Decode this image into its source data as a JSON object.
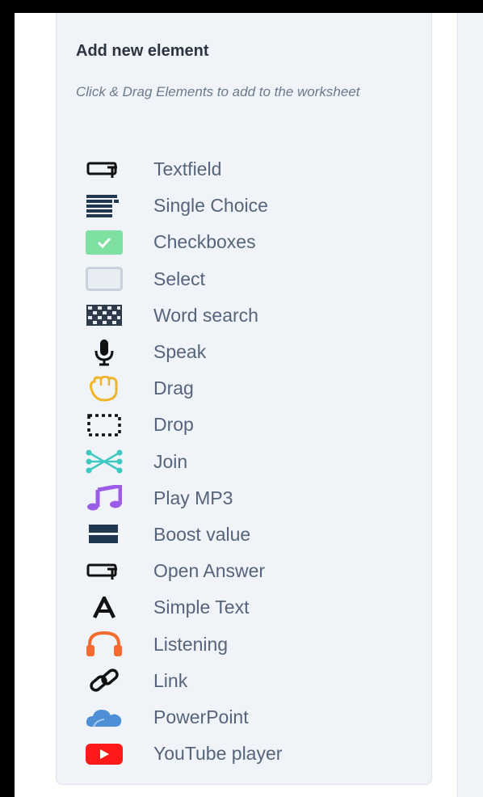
{
  "panel": {
    "title": "Add new element",
    "hint": "Click & Drag Elements to add to the worksheet"
  },
  "elements": [
    {
      "label": "Textfield",
      "icon": "textfield-icon"
    },
    {
      "label": "Single Choice",
      "icon": "single-choice-icon"
    },
    {
      "label": "Checkboxes",
      "icon": "checkbox-icon"
    },
    {
      "label": "Select",
      "icon": "select-icon"
    },
    {
      "label": "Word search",
      "icon": "word-search-icon"
    },
    {
      "label": "Speak",
      "icon": "microphone-icon"
    },
    {
      "label": "Drag",
      "icon": "hand-icon"
    },
    {
      "label": "Drop",
      "icon": "drop-zone-icon"
    },
    {
      "label": "Join",
      "icon": "join-icon"
    },
    {
      "label": "Play MP3",
      "icon": "music-note-icon"
    },
    {
      "label": "Boost value",
      "icon": "boost-value-icon"
    },
    {
      "label": "Open Answer",
      "icon": "open-answer-icon"
    },
    {
      "label": "Simple Text",
      "icon": "text-a-icon"
    },
    {
      "label": "Listening",
      "icon": "headphones-icon"
    },
    {
      "label": "Link",
      "icon": "link-icon"
    },
    {
      "label": "PowerPoint",
      "icon": "cloud-icon"
    },
    {
      "label": "YouTube player",
      "icon": "youtube-icon"
    }
  ],
  "colors": {
    "panel_bg": "#f0f4f9",
    "label_text": "#56647a",
    "checkbox_green": "#7ee0a1",
    "join_teal": "#3ec9c0",
    "music_purple": "#9b5de5",
    "hand_yellow": "#f0b429",
    "headphones_orange": "#f26b2f",
    "cloud_blue": "#4f8fd6",
    "youtube_red": "#ff1a1a",
    "dark_navy": "#1f3850"
  }
}
